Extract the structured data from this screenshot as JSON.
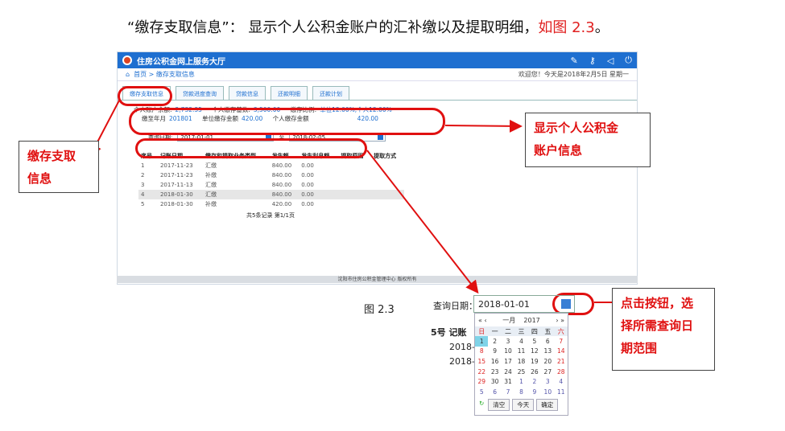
{
  "heading": {
    "main": "“缴存支取信息”：  显示个人公积金账户的汇补缴以及提取明细，",
    "ref": "如图  2.3",
    "end": "。"
  },
  "app": {
    "title": "住房公积金网上服务大厅",
    "breadcrumb": "首页 > 缴存支取信息",
    "welcome": "欢迎您！今天是2018年2月5日 星期一",
    "tabs": [
      "缴存支取信息",
      "贷款进度查询",
      "贷款信息",
      "还款明细",
      "还款计划"
    ],
    "info": {
      "balance_label": "个人账户余额:",
      "balance": "2,732.35",
      "base_label": "个人缴存基数:",
      "base": "3,500.00",
      "ratio_label": "缴存比例:",
      "ratio": "单位12.00%,个人12.00%",
      "paid_label": "缴至年月",
      "paid": "201801",
      "unit_amt_label": "单位缴存金额",
      "unit_amt": "420.00",
      "person_amt_label": "个人缴存金额",
      "person_amt": "420.00"
    },
    "query": {
      "label": "查询日期:",
      "from": "2017-01-01",
      "to_label": "至",
      "to": "2018-02-05"
    },
    "table": {
      "headers": [
        "序号",
        "记账日期",
        "缴存和提取业务类型",
        "发生额",
        "发生利息额",
        "提取原因",
        "提取方式"
      ],
      "rows": [
        [
          "1",
          "2017-11-23",
          "汇缴",
          "840.00",
          "0.00"
        ],
        [
          "2",
          "2017-11-23",
          "补缴",
          "840.00",
          "0.00"
        ],
        [
          "3",
          "2017-11-13",
          "汇缴",
          "840.00",
          "0.00"
        ],
        [
          "4",
          "2018-01-30",
          "汇缴",
          "840.00",
          "0.00"
        ],
        [
          "5",
          "2018-01-30",
          "补缴",
          "420.00",
          "0.00"
        ]
      ],
      "summary": "共5条记录    第1/1页"
    },
    "footer": "沈阳市住房公积金管理中心 版权所有"
  },
  "callouts": {
    "left": "缴存支取\n信息",
    "right1": "显示个人公积金\n账户信息",
    "right2": "点击按钮，选\n择所需查询日\n期范围"
  },
  "figure_label": "图 2.3",
  "calendar": {
    "query_label": "查询日期：",
    "query_value": "2018-01-01",
    "month": "一月",
    "year": "2017",
    "weekdays": [
      "日",
      "一",
      "二",
      "三",
      "四",
      "五",
      "六"
    ],
    "weeks": [
      [
        "1",
        "2",
        "3",
        "4",
        "5",
        "6",
        "7"
      ],
      [
        "8",
        "9",
        "10",
        "11",
        "12",
        "13",
        "14"
      ],
      [
        "15",
        "16",
        "17",
        "18",
        "19",
        "20",
        "21"
      ],
      [
        "22",
        "23",
        "24",
        "25",
        "26",
        "27",
        "28"
      ],
      [
        "29",
        "30",
        "31",
        "1",
        "2",
        "3",
        "4"
      ],
      [
        "5",
        "6",
        "7",
        "8",
        "9",
        "10",
        "11"
      ]
    ],
    "clear": "清空",
    "today": "今天",
    "ok": "确定",
    "partial_rows": [
      "2018-0",
      "2018-0"
    ],
    "partial_head": "记账"
  },
  "colors": {
    "accent": "#1e6fd0",
    "callout": "#e01010"
  }
}
